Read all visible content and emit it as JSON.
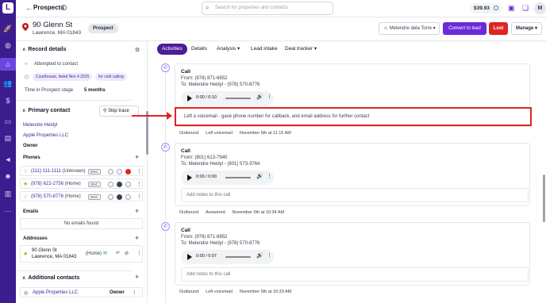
{
  "nav": {
    "logo": "L",
    "icons": [
      "rocket-icon",
      "globe-icon",
      "home-icon",
      "users-icon",
      "dollar-icon",
      "inbox-icon",
      "document-icon",
      "megaphone-icon",
      "team-icon",
      "chart-icon",
      "more-icon"
    ]
  },
  "topbar": {
    "back": "←",
    "title": "Prospects",
    "search_placeholder": "Search for properties and contacts",
    "credits": "$39.93",
    "avatar_initial": "M"
  },
  "property": {
    "street": "90 Glenn St",
    "city": "Lawrence, MA 01843",
    "stage_badge": "Prospect",
    "owner": "Melendre dela Torre",
    "convert_label": "Convert to lead",
    "lost_label": "Lost",
    "manage_label": "Manage"
  },
  "record": {
    "title": "Record details",
    "status": "Attempted to contact",
    "tag_source": "Courthouse, listed Nov 4 2025",
    "tag_call": "for cold calling",
    "time_label": "Time in Prospect stage",
    "time_value": "5 months"
  },
  "primary_contact": {
    "title": "Primary contact",
    "skip_trace": "Skip trace",
    "name": "Melendre Heidyl",
    "company": "Apple Properties LLC",
    "role": "Owner",
    "phones_title": "Phones",
    "phones": [
      {
        "number": "(111) 111-1111",
        "type": "(Unknown)",
        "dnc": "DNC"
      },
      {
        "number": "(978) 622-2756",
        "type": "(Home)",
        "dnc": "DNC"
      },
      {
        "number": "(978) 570-8776",
        "type": "(Home)",
        "dnc": "DNC"
      }
    ],
    "emails_title": "Emails",
    "no_emails": "No emails found",
    "addresses_title": "Addresses",
    "address_line1": "90 Glenn St",
    "address_line2": "Lawrence, MA 01843",
    "address_type": "(Home)"
  },
  "additional": {
    "title": "Additional contacts",
    "company": "Apple Properties LLC",
    "role": "Owner"
  },
  "tabs": [
    "Activities",
    "Details",
    "Analysis",
    "Lead intake",
    "Deal tracker"
  ],
  "activities": [
    {
      "title": "Call",
      "from": "From: (978) 871-6852",
      "to": "To: Melendre Heidyl - (978) 570-8776",
      "time": "0:00 / 0:10",
      "note": "Left a voicemail - gave phone number for callback, and email address for further contact",
      "direction": "Outbound",
      "result": "Left voicemail",
      "date": "November 5th at 11:15 AM"
    },
    {
      "title": "Call",
      "from": "From: (801) 613-7940",
      "to": "To: Melendre Heidyl - (801) 573-3764",
      "time": "0:00 / 0:00",
      "note_placeholder": "Add notes to this call",
      "direction": "Outbound",
      "result": "Answered",
      "date": "November 5th at 10:34 AM"
    },
    {
      "title": "Call",
      "from": "From: (978) 871-6852",
      "to": "To: Melendre Heidyl - (978) 570-8776",
      "time": "0:00 / 0:07",
      "note_placeholder": "Add notes to this call",
      "direction": "Outbound",
      "result": "Left voicemail",
      "date": "November 5th at 10:33 AM"
    }
  ],
  "colors": {
    "nav_bg": "#3b1d8f",
    "accent": "#6d28d9",
    "danger": "#dc2626",
    "highlight": "#e02424"
  }
}
